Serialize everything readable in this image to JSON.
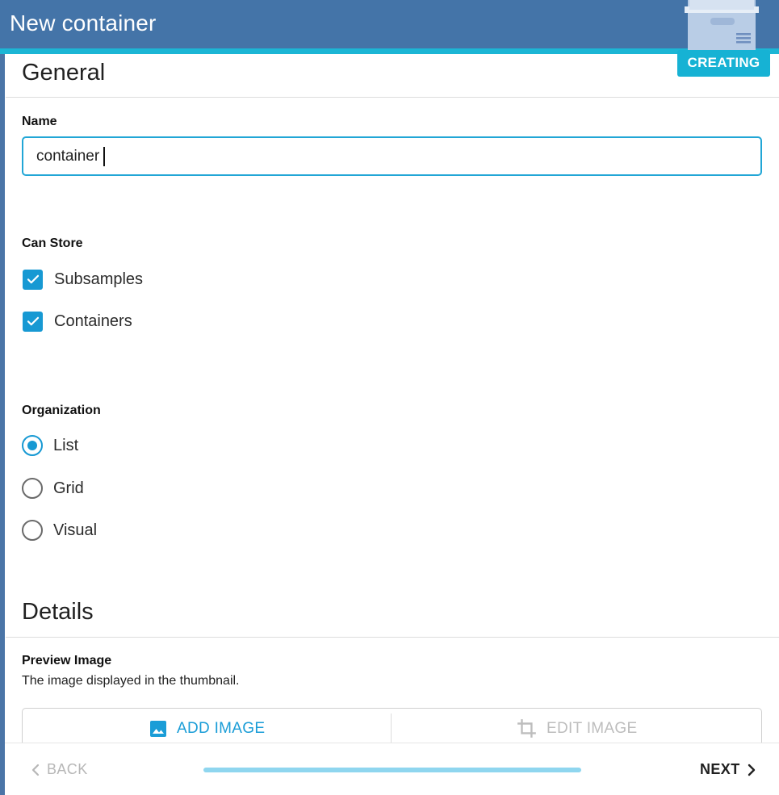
{
  "header": {
    "title": "New container",
    "status_badge": "CREATING",
    "icon": "container-box-icon"
  },
  "sections": {
    "general": {
      "title": "General",
      "name_field": {
        "label": "Name",
        "value": "container"
      },
      "can_store": {
        "label": "Can Store",
        "options": [
          {
            "label": "Subsamples",
            "checked": true
          },
          {
            "label": "Containers",
            "checked": true
          }
        ]
      },
      "organization": {
        "label": "Organization",
        "options": [
          {
            "label": "List",
            "selected": true
          },
          {
            "label": "Grid",
            "selected": false
          },
          {
            "label": "Visual",
            "selected": false
          }
        ]
      }
    },
    "details": {
      "title": "Details",
      "preview_image": {
        "label": "Preview Image",
        "helper": "The image displayed in the thumbnail.",
        "add_label": "ADD IMAGE",
        "edit_label": "EDIT IMAGE"
      }
    }
  },
  "footer": {
    "back_label": "BACK",
    "next_label": "NEXT",
    "progress": 1.0
  },
  "colors": {
    "header_bg": "#4474a8",
    "accent": "#1cb6d5",
    "primary": "#1799d3"
  }
}
